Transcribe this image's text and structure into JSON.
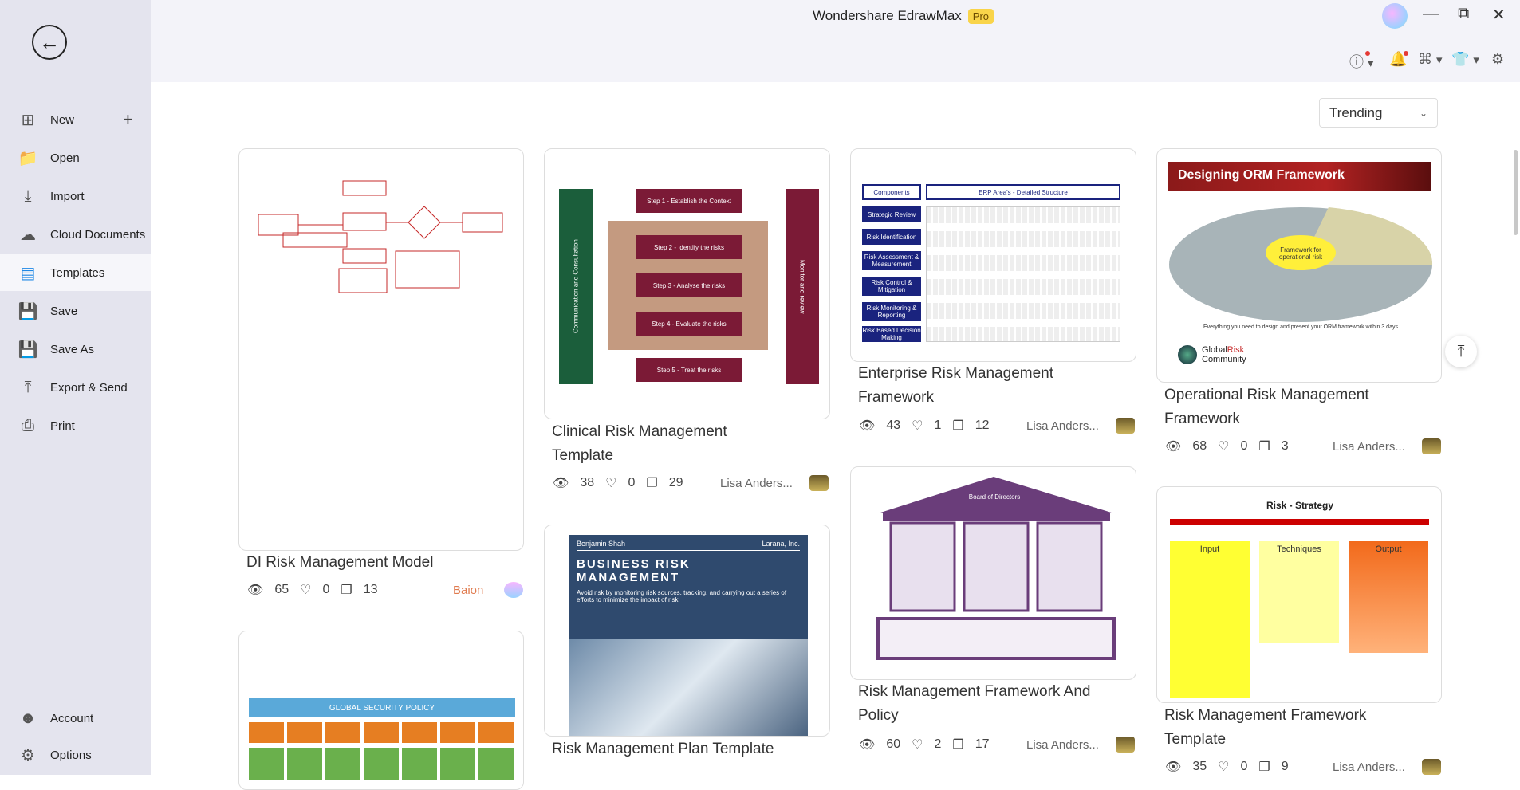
{
  "app": {
    "title": "Wondershare EdrawMax",
    "badge": "Pro"
  },
  "sidebar": {
    "items": [
      {
        "label": "New",
        "icon": "plus-square-icon"
      },
      {
        "label": "Open",
        "icon": "folder-icon"
      },
      {
        "label": "Import",
        "icon": "import-icon"
      },
      {
        "label": "Cloud Documents",
        "icon": "cloud-icon"
      },
      {
        "label": "Templates",
        "icon": "templates-icon"
      },
      {
        "label": "Save",
        "icon": "save-icon"
      },
      {
        "label": "Save As",
        "icon": "save-as-icon"
      },
      {
        "label": "Export & Send",
        "icon": "export-icon"
      },
      {
        "label": "Print",
        "icon": "print-icon"
      }
    ],
    "bottom": [
      {
        "label": "Account",
        "icon": "account-icon"
      },
      {
        "label": "Options",
        "icon": "gear-icon"
      }
    ],
    "active": "Templates"
  },
  "sort": {
    "selected": "Trending"
  },
  "cards": [
    {
      "title": "DI Risk Management Model",
      "views": "65",
      "likes": "0",
      "copies": "13",
      "author": "Baion"
    },
    {
      "title": "Clinical Risk Management Template",
      "views": "38",
      "likes": "0",
      "copies": "29",
      "author": "Lisa Anders..."
    },
    {
      "title": "Enterprise Risk Management Framework",
      "views": "43",
      "likes": "1",
      "copies": "12",
      "author": "Lisa Anders..."
    },
    {
      "title": "Operational Risk Management Framework",
      "views": "68",
      "likes": "0",
      "copies": "3",
      "author": "Lisa Anders..."
    },
    {
      "title": "Risk Management Plan Template",
      "views": "",
      "likes": "",
      "copies": "",
      "author": ""
    },
    {
      "title": "Risk Management Framework And Policy",
      "views": "60",
      "likes": "2",
      "copies": "17",
      "author": "Lisa Anders..."
    },
    {
      "title": "Risk Management Framework Template",
      "views": "35",
      "likes": "0",
      "copies": "9",
      "author": "Lisa Anders..."
    },
    {
      "title": "",
      "views": "",
      "likes": "",
      "copies": "",
      "author": ""
    }
  ],
  "thumbs": {
    "clinical": {
      "steps": [
        "Step 1 - Establish the Context",
        "Step 2 - Identify the risks",
        "Step 3 - Analyse the risks",
        "Step 4 - Evaluate the risks",
        "Step 5 - Treat the risks"
      ],
      "left": "Communication and Consultation",
      "right": "Monitor and review"
    },
    "erm": {
      "h1": "Components",
      "h2": "ERP Area's - Detailed Structure",
      "rows": [
        "Strategic Review",
        "Risk Identification",
        "Risk Assessment & Measurement",
        "Risk Control & Mitigation",
        "Risk Monitoring & Reporting",
        "Risk Based Decision Making"
      ]
    },
    "orm": {
      "title": "Designing ORM Framework",
      "center": "Framework for operational risk",
      "footer": "Everything you need to design and present your ORM framework within 3 days",
      "brand1": "Global",
      "brand2": "Risk",
      "brand3": "Community"
    },
    "plan": {
      "author": "Benjamin Shah",
      "company": "Larana, Inc.",
      "title": "BUSINESS RISK MANAGEMENT",
      "desc": "Avoid risk by monitoring risk sources, tracking, and carrying out a series of efforts to minimize the impact of risk."
    },
    "policy": {
      "roof": "Board of Directors"
    },
    "strategy": {
      "title": "Risk - Strategy",
      "cols": [
        "Input",
        "Techniques",
        "Output"
      ]
    },
    "security": {
      "title": "GLOBAL SECURITY POLICY"
    }
  },
  "colors": {
    "sidebar": "#e4e4ee",
    "accent": "#f9d44a",
    "author_highlight": "#e07b4f"
  }
}
